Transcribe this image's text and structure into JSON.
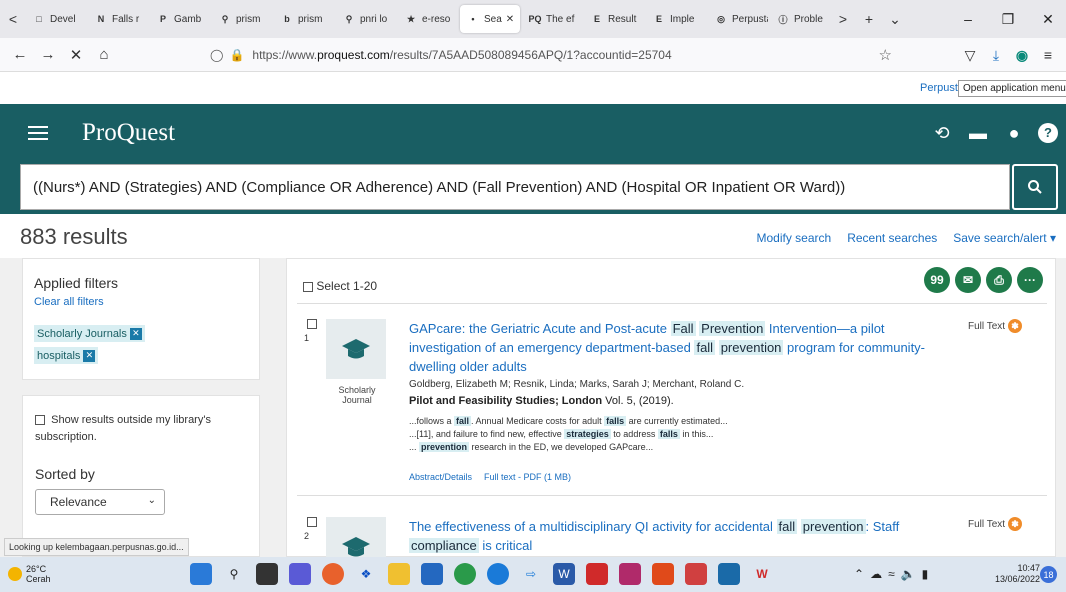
{
  "browser": {
    "tabs": [
      {
        "label": "Devel",
        "icon": "page-icon"
      },
      {
        "label": "Falls r",
        "icon": "n-logo-icon"
      },
      {
        "label": "Gamb",
        "icon": "pkp-logo-icon"
      },
      {
        "label": "prism",
        "icon": "search-icon"
      },
      {
        "label": "prism",
        "icon": "bing-icon"
      },
      {
        "label": "pnri lo",
        "icon": "search-icon"
      },
      {
        "label": "e-reso",
        "icon": "star-icon"
      },
      {
        "label": "Sea",
        "icon": "dot-icon",
        "active": true
      },
      {
        "label": "The ef",
        "icon": "pq-icon"
      },
      {
        "label": "Result",
        "icon": "e-logo-icon"
      },
      {
        "label": "Imple",
        "icon": "e-logo-icon"
      },
      {
        "label": "Perpustak",
        "icon": "globe-icon"
      },
      {
        "label": "Proble",
        "icon": "info-icon"
      }
    ],
    "url_prefix": "https://www.",
    "url_domain": "proquest.com",
    "url_path": "/results/7A5AAD508089456APQ/1?accountid=25704"
  },
  "page": {
    "perpus_link": "Perpust",
    "tooltip": "Open application menu",
    "brand": "ProQuest",
    "query": "((Nurs*) AND (Strategies) AND (Compliance OR Adherence) AND  (Fall Prevention) AND (Hospital OR Inpatient OR Ward))",
    "results_count": "883 results",
    "modify_search": "Modify search",
    "recent_searches": "Recent searches",
    "save_search": "Save search/alert ▾"
  },
  "filters": {
    "heading": "Applied filters",
    "clear_all": "Clear all filters",
    "chips": [
      "Scholarly Journals",
      "hospitals"
    ],
    "outside_label": "Show results outside my library's subscription.",
    "sort_label": "Sorted by",
    "sort_value": "Relevance"
  },
  "results": {
    "select_label": "Select 1-20",
    "items": [
      {
        "num": "1",
        "type_caption": "Scholarly Journal",
        "title_parts": [
          {
            "t": "GAPcare: the Geriatric Acute and Post-acute "
          },
          {
            "t": "Fall",
            "h": true
          },
          {
            "t": " "
          },
          {
            "t": "Prevention",
            "h": true
          },
          {
            "t": " Intervention—a pilot investigation of an emergency department-based "
          },
          {
            "t": "fall",
            "h": true
          },
          {
            "t": " "
          },
          {
            "t": "prevention",
            "h": true
          },
          {
            "t": " program for community-dwelling older adults"
          }
        ],
        "full_text": "Full Text",
        "authors": "Goldberg, Elizabeth M; Resnik, Linda; Marks, Sarah J; Merchant, Roland C.",
        "journal": "Pilot and Feasibility Studies; London",
        "volume": " Vol. 5,  (2019).",
        "snippets": [
          [
            {
              "t": "...follows a "
            },
            {
              "t": "fall",
              "h": true
            },
            {
              "t": ". Annual Medicare costs for adult "
            },
            {
              "t": "falls",
              "h": true
            },
            {
              "t": " are currently estimated..."
            }
          ],
          [
            {
              "t": "...[11], and failure to find new, effective "
            },
            {
              "t": "strategies",
              "h": true
            },
            {
              "t": " to address "
            },
            {
              "t": "falls",
              "h": true
            },
            {
              "t": " in this..."
            }
          ],
          [
            {
              "t": "... "
            },
            {
              "t": "prevention",
              "h": true
            },
            {
              "t": " research in the ED, we developed GAPcare..."
            }
          ]
        ],
        "abstract_link": "Abstract/Details",
        "pdf_link": "Full text - PDF (1 MB)"
      },
      {
        "num": "2",
        "title_parts": [
          {
            "t": "The effectiveness of a multidisciplinary QI activity for accidental "
          },
          {
            "t": "fall",
            "h": true
          },
          {
            "t": " "
          },
          {
            "t": "prevention",
            "h": true
          },
          {
            "t": ": Staff "
          },
          {
            "t": "compliance",
            "h": true
          },
          {
            "t": " is critical"
          }
        ],
        "full_text": "Full Text"
      }
    ]
  },
  "status_text": "Looking up kelembagaan.perpusnas.go.id...",
  "taskbar": {
    "temp": "26°C",
    "condition": "Cerah",
    "time": "10:47",
    "date": "13/06/2022",
    "notifications": "18"
  }
}
